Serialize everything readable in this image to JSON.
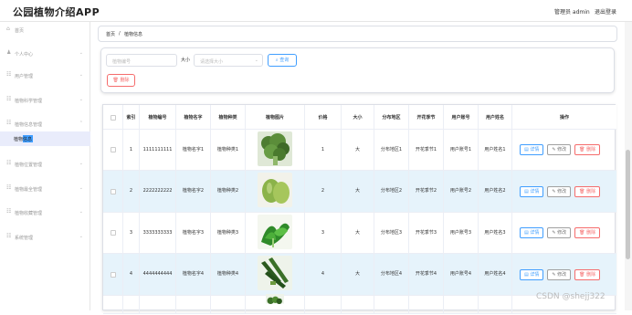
{
  "header": {
    "title": "公园植物介绍APP",
    "admin": "管理员 admin",
    "logout": "退出登录"
  },
  "sidebar": {
    "items": [
      {
        "label": "首页",
        "icon": "⌂",
        "has_arrow": false
      },
      {
        "label": "个人中心",
        "icon": "♟",
        "has_arrow": true
      },
      {
        "label": "用户管理",
        "icon": "☷",
        "has_arrow": true
      },
      {
        "label": "植物科学管理",
        "icon": "☷",
        "has_arrow": true
      },
      {
        "label": "植物信息管理",
        "icon": "☷",
        "has_arrow": true
      },
      {
        "label": "植物位置管理",
        "icon": "☷",
        "has_arrow": true
      },
      {
        "label": "植物最全管理",
        "icon": "☷",
        "has_arrow": true
      },
      {
        "label": "植物收藏管理",
        "icon": "☷",
        "has_arrow": true
      },
      {
        "label": "系统管理",
        "icon": "☷",
        "has_arrow": true
      }
    ],
    "active_sub": "植物信息"
  },
  "breadcrumb": {
    "home": "首页",
    "sep": "/",
    "current": "植物信息"
  },
  "search": {
    "plant_no_placeholder": "植物编号",
    "size_label": "大小",
    "size_placeholder": "请选择大小",
    "search_btn": "查询",
    "delete_btn": "删除"
  },
  "table": {
    "headers": [
      "索引",
      "植物编号",
      "植物名字",
      "植物种类",
      "植物图片",
      "价格",
      "大小",
      "分布地区",
      "开花季节",
      "用户账号",
      "用户姓名",
      "操作"
    ],
    "rows": [
      {
        "idx": "1",
        "no": "1111111111",
        "name": "植物名字1",
        "type": "植物种类1",
        "price": "1",
        "size": "大",
        "region": "分布地区1",
        "season": "开花季节1",
        "account": "用户账号1",
        "user": "用户姓名1",
        "img": "broccoli"
      },
      {
        "idx": "2",
        "no": "2222222222",
        "name": "植物名字2",
        "type": "植物种类2",
        "price": "2",
        "size": "大",
        "region": "分布地区2",
        "season": "开花季节2",
        "account": "用户账号2",
        "user": "用户姓名2",
        "img": "melon"
      },
      {
        "idx": "3",
        "no": "3333333333",
        "name": "植物名字3",
        "type": "植物种类3",
        "price": "3",
        "size": "大",
        "region": "分布地区3",
        "season": "开花季节3",
        "account": "用户账号3",
        "user": "用户姓名3",
        "img": "greens"
      },
      {
        "idx": "4",
        "no": "4444444444",
        "name": "植物名字4",
        "type": "植物种类4",
        "price": "4",
        "size": "大",
        "region": "分布地区4",
        "season": "开花季节4",
        "account": "用户账号4",
        "user": "用户姓名4",
        "img": "cucumber"
      },
      {
        "idx": "",
        "no": "",
        "name": "",
        "type": "",
        "price": "",
        "size": "",
        "region": "",
        "season": "",
        "account": "",
        "user": "",
        "img": "partial"
      }
    ],
    "op_labels": {
      "info": "详情",
      "edit": "修改",
      "del": "删除"
    }
  },
  "watermark": "CSDN @shejj322",
  "colors": {
    "accent": "#409eff",
    "danger": "#f56c6c",
    "row_alt": "#e6f3fb",
    "active_bg": "#e9ecfb"
  }
}
